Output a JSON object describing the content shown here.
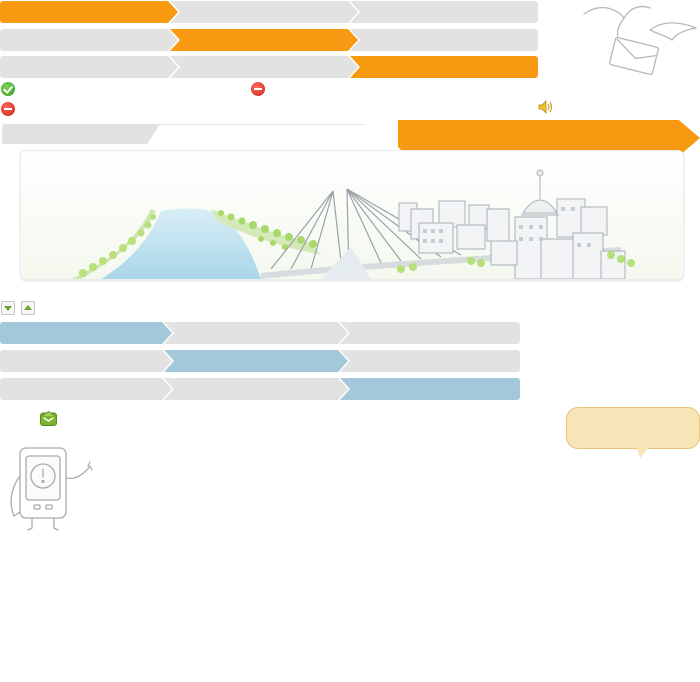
{
  "colors": {
    "accent_orange": "#f89a11",
    "accent_blue": "#a2c8d9",
    "step_gray": "#e2e2e2",
    "bubble_fill": "#f7e5b8"
  },
  "orange_steps": {
    "rows": [
      {
        "active_index": 0,
        "steps": [
          "",
          "",
          ""
        ]
      },
      {
        "active_index": 1,
        "steps": [
          "",
          "",
          ""
        ]
      },
      {
        "active_index": 2,
        "steps": [
          "",
          "",
          ""
        ]
      }
    ]
  },
  "blue_steps": {
    "rows": [
      {
        "active_index": 0,
        "steps": [
          "",
          "",
          ""
        ]
      },
      {
        "active_index": 1,
        "steps": [
          "",
          "",
          ""
        ]
      },
      {
        "active_index": 2,
        "steps": [
          "",
          "",
          ""
        ]
      }
    ]
  },
  "icons": {
    "status_ok": "check-icon",
    "status_stop_1": "stop-icon",
    "status_stop_2": "stop-icon",
    "speaker": "speaker-icon",
    "mail_birds": "mail-envelope-icon",
    "scroll_down": "arrow-down-icon",
    "scroll_up": "arrow-up-icon",
    "inbox": "open-envelope-icon",
    "phone_mascot": "phone-alert-mascot-icon"
  },
  "tab": {
    "label": ""
  },
  "banner": {
    "label": ""
  },
  "bubble": {
    "text": ""
  },
  "hero": {
    "illustration": "city-bridge-illustration"
  }
}
